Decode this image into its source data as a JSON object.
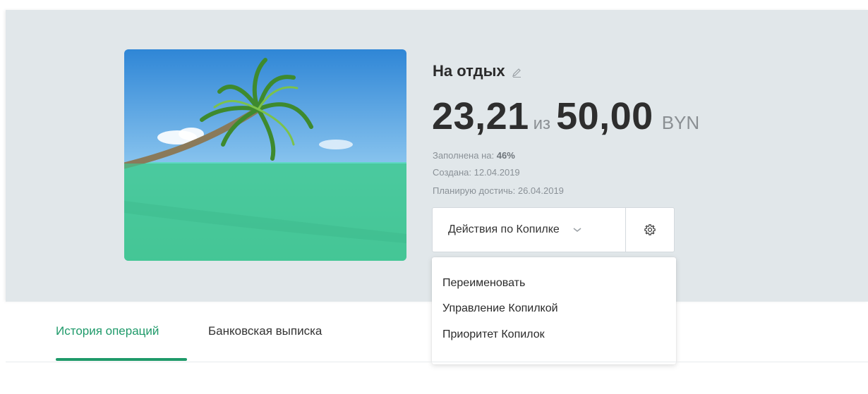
{
  "goal": {
    "title": "На отдых",
    "current_amount": "23,21",
    "of_label": "из",
    "target_amount": "50,00",
    "currency": "BYN",
    "progress_percent": 46,
    "fill_label": "Заполнена на:",
    "fill_value": "46%",
    "created_text": "Создана: 12.04.2019",
    "plan_text": "Планирую достичь: 26.04.2019"
  },
  "actions": {
    "select_label": "Действия по Копилке"
  },
  "dropdown": {
    "items": [
      "Переименовать",
      "Управление Копилкой",
      "Приоритет Копилок"
    ]
  },
  "tabs": [
    {
      "label": "История операций",
      "active": true
    },
    {
      "label": "Банковская выписка",
      "active": false
    }
  ],
  "icons": {
    "edit": "pencil-icon",
    "chevron": "chevron-down-icon",
    "settings": "gear-icon"
  },
  "colors": {
    "accent": "#1f9a6a",
    "panel_background": "#e1e7ea",
    "progress_overlay": "#43c38f"
  }
}
